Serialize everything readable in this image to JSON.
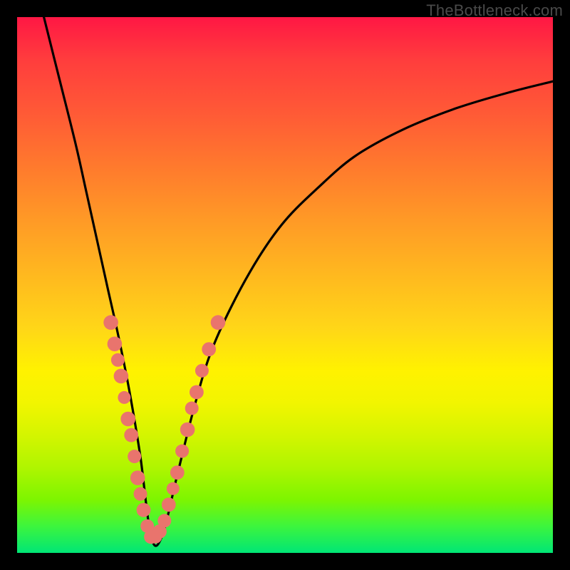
{
  "watermark": "TheBottleneck.com",
  "colors": {
    "bead": "#e9746d",
    "curve": "#000000",
    "frame": "#000000"
  },
  "chart_data": {
    "type": "line",
    "title": "",
    "xlabel": "",
    "ylabel": "",
    "xlim": [
      0,
      100
    ],
    "ylim": [
      0,
      100
    ],
    "grid": false,
    "legend": false,
    "comment": "Axes are unlabeled in the source image; x and y treated as 0–100 percent of plot width/height. y=0 at bottom (green), y=100 at top (red). Curve is a V-shaped bottleneck profile with minimum near x≈25.",
    "series": [
      {
        "name": "bottleneck-curve",
        "x": [
          5,
          8,
          11,
          13,
          15,
          17,
          19,
          21,
          23,
          25,
          27,
          30,
          33,
          36,
          40,
          45,
          50,
          56,
          63,
          72,
          82,
          92,
          100
        ],
        "y": [
          100,
          88,
          76,
          67,
          58,
          49,
          40,
          30,
          18,
          3,
          3,
          15,
          27,
          37,
          46,
          55,
          62,
          68,
          74,
          79,
          83,
          86,
          88
        ]
      }
    ],
    "beads": {
      "comment": "Salmon circular markers clustered on both arms of the V near the bottom.",
      "points": [
        {
          "x": 17.5,
          "y": 43,
          "r": 1.4
        },
        {
          "x": 18.2,
          "y": 39,
          "r": 1.4
        },
        {
          "x": 18.8,
          "y": 36,
          "r": 1.2
        },
        {
          "x": 19.4,
          "y": 33,
          "r": 1.4
        },
        {
          "x": 20.0,
          "y": 29,
          "r": 1.1
        },
        {
          "x": 20.7,
          "y": 25,
          "r": 1.4
        },
        {
          "x": 21.3,
          "y": 22,
          "r": 1.3
        },
        {
          "x": 21.9,
          "y": 18,
          "r": 1.2
        },
        {
          "x": 22.5,
          "y": 14,
          "r": 1.4
        },
        {
          "x": 23.0,
          "y": 11,
          "r": 1.2
        },
        {
          "x": 23.6,
          "y": 8,
          "r": 1.3
        },
        {
          "x": 24.3,
          "y": 5,
          "r": 1.2
        },
        {
          "x": 25.0,
          "y": 3,
          "r": 1.3
        },
        {
          "x": 25.8,
          "y": 3,
          "r": 1.2
        },
        {
          "x": 26.6,
          "y": 4,
          "r": 1.3
        },
        {
          "x": 27.5,
          "y": 6,
          "r": 1.2
        },
        {
          "x": 28.3,
          "y": 9,
          "r": 1.3
        },
        {
          "x": 29.1,
          "y": 12,
          "r": 1.1
        },
        {
          "x": 29.9,
          "y": 15,
          "r": 1.3
        },
        {
          "x": 30.8,
          "y": 19,
          "r": 1.2
        },
        {
          "x": 31.8,
          "y": 23,
          "r": 1.4
        },
        {
          "x": 32.6,
          "y": 27,
          "r": 1.2
        },
        {
          "x": 33.5,
          "y": 30,
          "r": 1.3
        },
        {
          "x": 34.5,
          "y": 34,
          "r": 1.2
        },
        {
          "x": 35.8,
          "y": 38,
          "r": 1.3
        },
        {
          "x": 37.5,
          "y": 43,
          "r": 1.4
        }
      ]
    }
  }
}
